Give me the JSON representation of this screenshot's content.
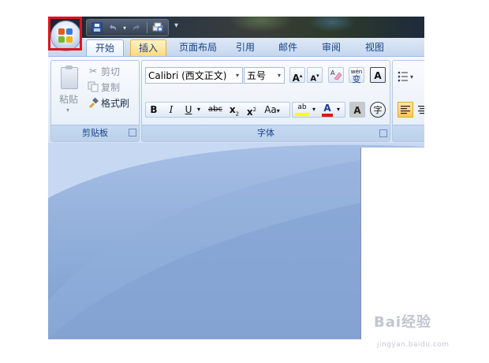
{
  "quick_access": {
    "save_icon": "save-icon",
    "undo_icon": "undo-icon",
    "redo_icon": "redo-icon",
    "print_icon": "print-preview-icon",
    "customize_icon": "customize-qat-icon"
  },
  "office_button": {
    "icon": "office-logo-icon",
    "highlight_color": "#e0141e"
  },
  "tabs": [
    {
      "label": "开始"
    },
    {
      "label": "插入"
    },
    {
      "label": "页面布局"
    },
    {
      "label": "引用"
    },
    {
      "label": "邮件"
    },
    {
      "label": "审阅"
    },
    {
      "label": "视图"
    }
  ],
  "clipboard": {
    "title": "剪贴板",
    "paste_label": "粘贴",
    "cut_label": "剪切",
    "copy_label": "复制",
    "format_painter_label": "格式刷"
  },
  "font": {
    "title": "字体",
    "font_name": "Calibri (西文正文)",
    "font_size": "五号",
    "grow_label": "A",
    "shrink_label": "A",
    "clear_label": "A",
    "phonetic_label": "wén",
    "phonetic_char": "变",
    "border_label": "A",
    "bold": "B",
    "italic": "I",
    "underline": "U",
    "strike": "abc",
    "subscript": "x",
    "superscript": "x",
    "change_case": "Aa",
    "highlight": "ab",
    "font_color": "A",
    "shading": "A",
    "enclose_char": "字"
  },
  "paragraph": {
    "bullets_icon": "bullets-icon"
  },
  "colors": {
    "accent": "#15428b",
    "highlight_yellow": "#ffff00",
    "font_red": "#e0141e",
    "tab_insert": "#ffd97a"
  },
  "watermark": {
    "brand": "Bai经验",
    "url": "jingyan.baidu.com"
  }
}
